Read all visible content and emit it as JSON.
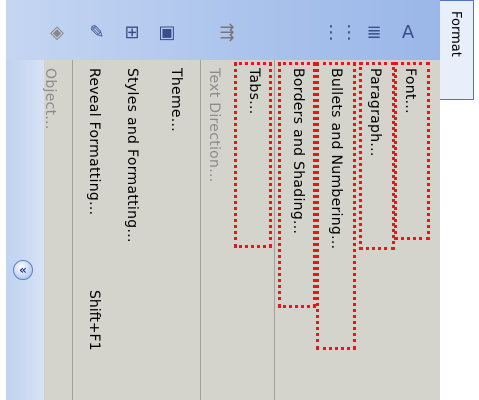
{
  "menu": {
    "tab_label": "Format",
    "icons": [
      "font-icon",
      "paragraph-icon",
      "bullets-icon",
      "text-direction-icon",
      "frame-icon",
      "tab-style-icon",
      "brush-icon",
      "picture-icon"
    ],
    "expander_label": "«",
    "items": [
      {
        "label": "Font...",
        "enabled": true
      },
      {
        "label": "Paragraph...",
        "enabled": true
      },
      {
        "label": "Bullets and Numbering...",
        "enabled": true
      },
      {
        "label": "Borders and Shading...",
        "enabled": true
      },
      {
        "label": "Tabs...",
        "enabled": true
      },
      {
        "label": "Text Direction...",
        "enabled": false
      },
      {
        "label": "Theme...",
        "enabled": true
      },
      {
        "label": "Styles and Formatting...",
        "enabled": true
      },
      {
        "label": "Reveal Formatting...",
        "shortcut": "Shift+F1",
        "enabled": true
      },
      {
        "label": "Object...",
        "enabled": false
      }
    ]
  },
  "colors": {
    "highlight": "#e8141e",
    "toolbar": "#a9c2ec",
    "menu_bg": "#d4d4cc"
  }
}
